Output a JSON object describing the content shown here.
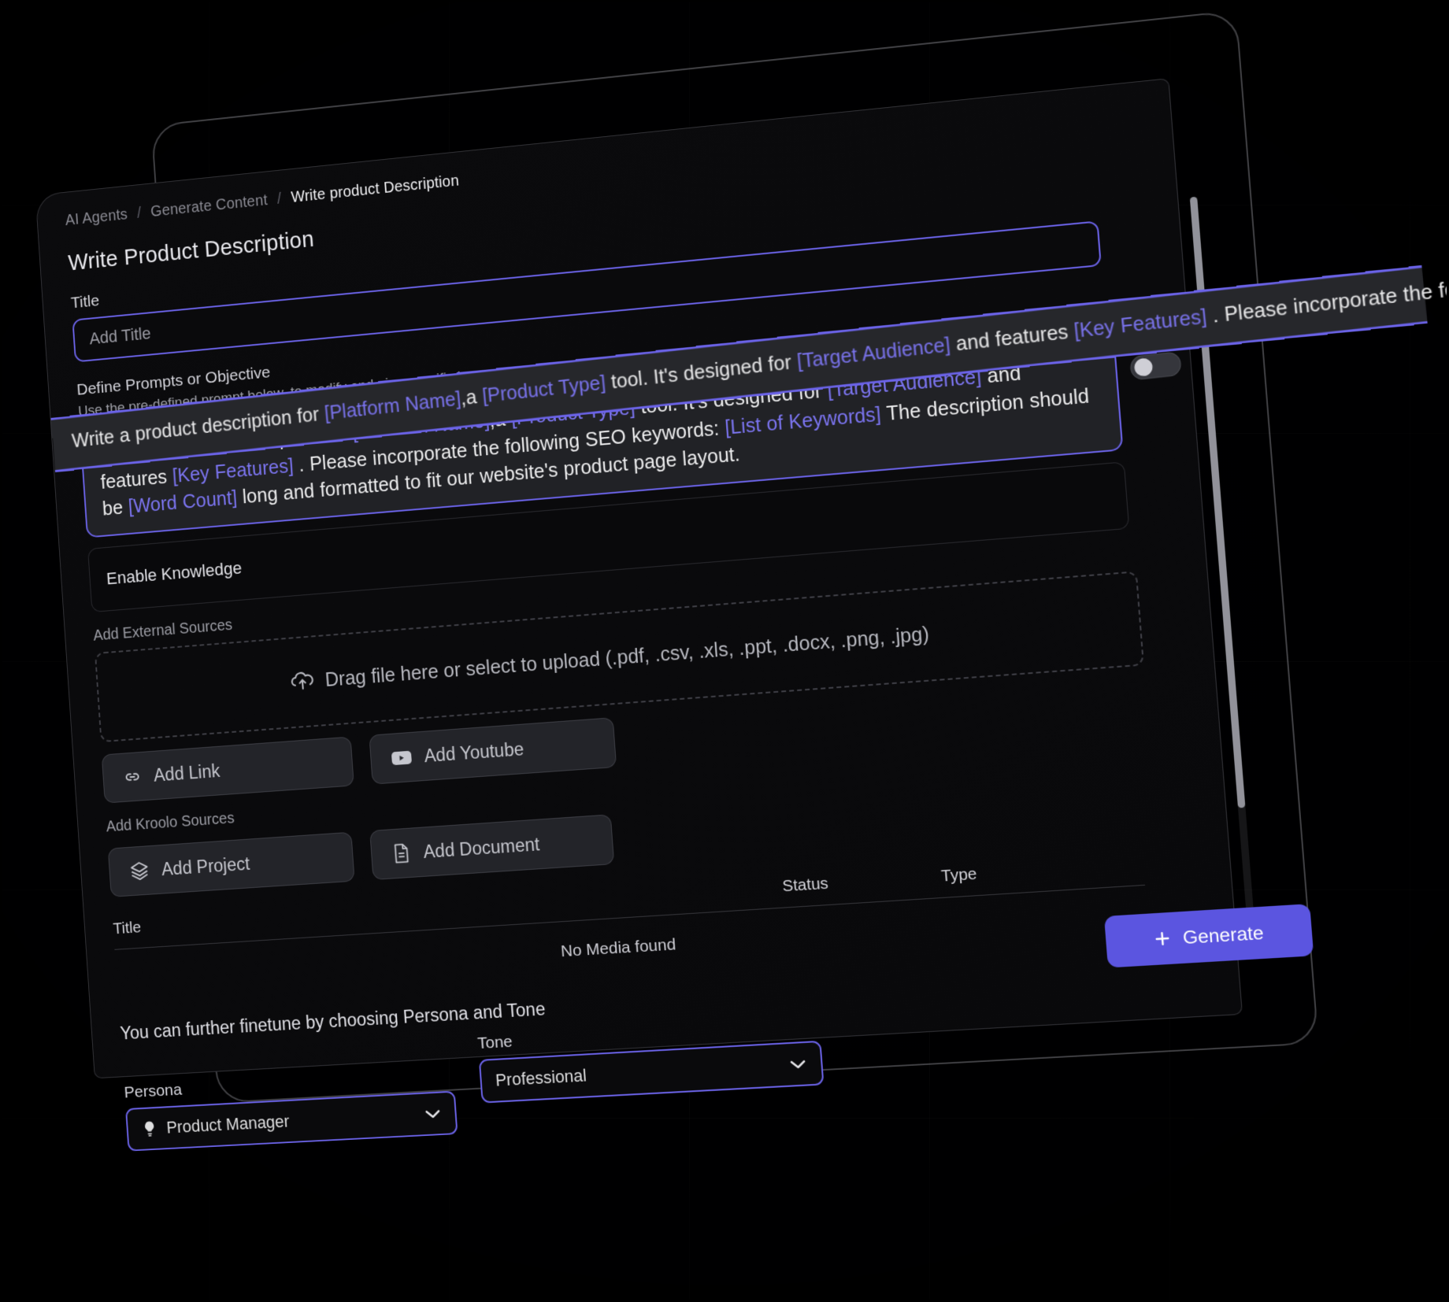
{
  "breadcrumb": {
    "items": [
      "AI Agents",
      "Generate Content",
      "Write product Description"
    ],
    "separator": "/"
  },
  "page": {
    "title": "Write Product Description"
  },
  "title_field": {
    "label": "Title",
    "placeholder": "Add Title",
    "value": ""
  },
  "prompt_section": {
    "heading": "Define Prompts or Objective",
    "subheading": "Use the pre-defined prompt below, to modify and give specific instructions",
    "text_parts": [
      {
        "t": "Write a product description for ",
        "ph": false
      },
      {
        "t": "[Platform Name]",
        "ph": true
      },
      {
        "t": ",a ",
        "ph": false
      },
      {
        "t": "[Product Type]",
        "ph": true
      },
      {
        "t": " tool. It's designed for ",
        "ph": false
      },
      {
        "t": "[Target Audience]",
        "ph": true
      },
      {
        "t": " and features ",
        "ph": false
      },
      {
        "t": "[Key Features]",
        "ph": true
      },
      {
        "t": " . Please incorporate the following SEO keywords: ",
        "ph": false
      },
      {
        "t": "[List of Keywords]",
        "ph": true
      },
      {
        "t": " The description should be ",
        "ph": false
      },
      {
        "t": "[Word Count]",
        "ph": true
      },
      {
        "t": " long and formatted to fit our website's product page layout.",
        "ph": false
      }
    ]
  },
  "knowledge": {
    "label": "Enable Knowledge",
    "toggle_state": "off"
  },
  "external_sources": {
    "label": "Add External Sources",
    "dropzone_text": "Drag file here or select to upload (.pdf, .csv, .xls, .ppt, .docx, .png, .jpg)",
    "buttons": [
      {
        "label": "Add Link",
        "icon": "link-icon"
      },
      {
        "label": "Add Youtube",
        "icon": "youtube-icon"
      }
    ]
  },
  "kroolo_sources": {
    "label": "Add Kroolo Sources",
    "buttons": [
      {
        "label": "Add Project",
        "icon": "layers-icon"
      },
      {
        "label": "Add Document",
        "icon": "document-icon"
      }
    ]
  },
  "media_table": {
    "columns": [
      "Title",
      "Status",
      "Type"
    ],
    "empty_text": "No Media found",
    "rows": []
  },
  "finetune": {
    "text": "You can further finetune by choosing Persona and Tone",
    "persona": {
      "label": "Persona",
      "value": "Product Manager",
      "icon": "bulb-icon"
    },
    "tone": {
      "label": "Tone",
      "value": "Professional"
    }
  },
  "actions": {
    "generate_label": "Generate",
    "generate_icon": "plus-icon"
  },
  "colors": {
    "accent": "#6b63e8",
    "accent_button": "#5b55e0",
    "placeholder_text": "#7b74ef",
    "panel_bg": "#0a0a0c",
    "prompt_bg": "#212226"
  }
}
